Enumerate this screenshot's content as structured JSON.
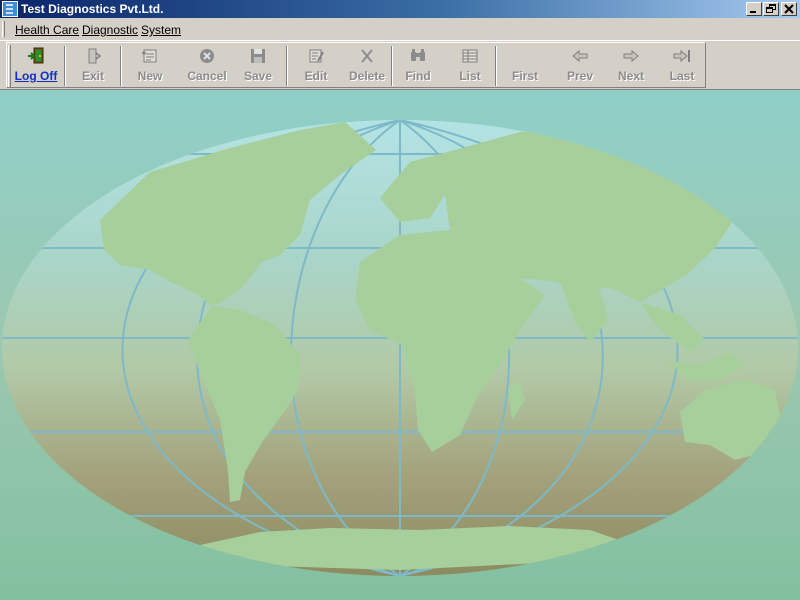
{
  "window": {
    "title": "Test Diagnostics Pvt.Ltd.",
    "icon": "app-icon",
    "controls": [
      "minimize-icon",
      "restore-icon",
      "close-icon"
    ]
  },
  "menu": {
    "items": [
      {
        "label": "Health Care",
        "mnemonic": "H"
      },
      {
        "label": "Diagnostic",
        "mnemonic": "D"
      },
      {
        "label": "System",
        "mnemonic": "S"
      }
    ]
  },
  "toolbar": {
    "buttons": [
      {
        "label": "Log Off",
        "icon": "exit-door-icon",
        "enabled": true
      },
      {
        "label": "Exit",
        "icon": "door-icon",
        "enabled": false
      },
      {
        "label": "New",
        "icon": "new-record-icon",
        "enabled": false
      },
      {
        "label": "Cancel",
        "icon": "cancel-icon",
        "enabled": false
      },
      {
        "label": "Save",
        "icon": "floppy-disk-icon",
        "enabled": false
      },
      {
        "label": "Edit",
        "icon": "edit-icon",
        "enabled": false
      },
      {
        "label": "Delete",
        "icon": "delete-x-icon",
        "enabled": false
      },
      {
        "label": "Find",
        "icon": "binoculars-icon",
        "enabled": false
      },
      {
        "label": "List",
        "icon": "list-grid-icon",
        "enabled": false
      },
      {
        "label": "First",
        "icon": "first-record-icon",
        "enabled": false
      },
      {
        "label": "Prev",
        "icon": "arrow-left-icon",
        "enabled": false
      },
      {
        "label": "Next",
        "icon": "arrow-right-icon",
        "enabled": false
      },
      {
        "label": "Last",
        "icon": "last-record-icon",
        "enabled": false
      }
    ]
  },
  "background": {
    "image": "world-map",
    "colors": {
      "sky": "#86c9c0",
      "land": "#a6cf9c",
      "gridline": "#7eb9c9",
      "lower": "#8a8a5e"
    }
  }
}
